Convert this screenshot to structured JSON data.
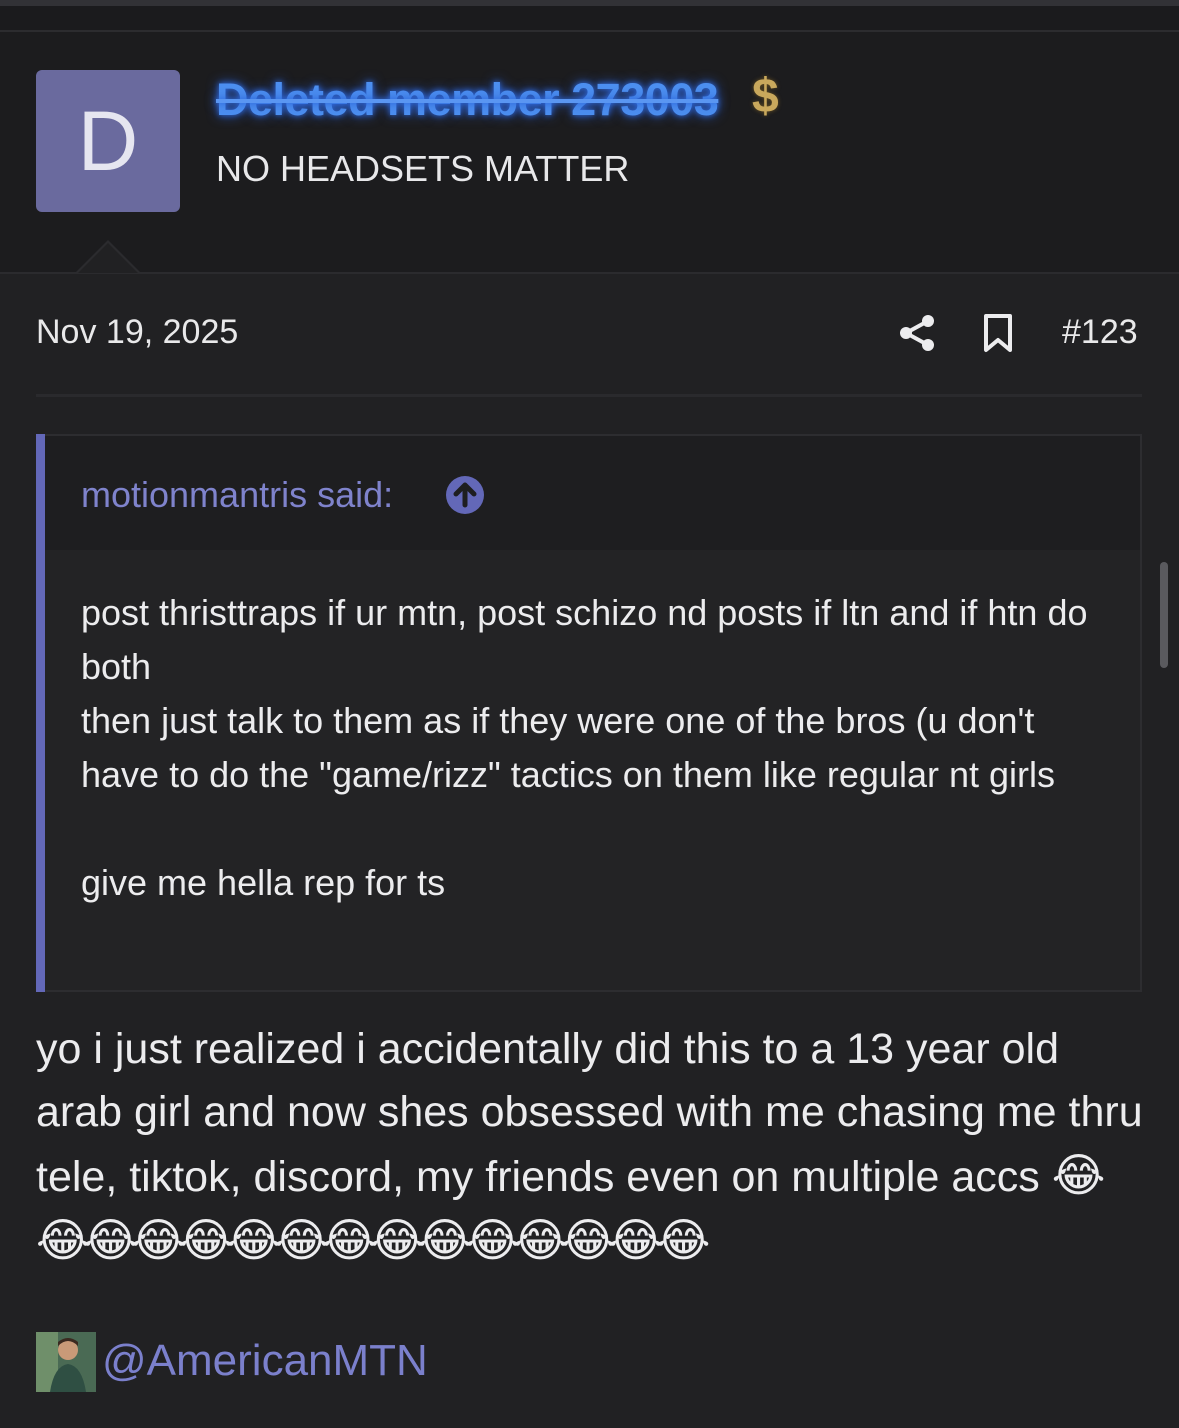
{
  "post": {
    "author": {
      "initial": "D",
      "name": "Deleted member 273003",
      "title": "NO HEADSETS MATTER",
      "badge_icon": "dollar-icon",
      "name_color": "#4c8ff0",
      "avatar_color": "#6a6a9e"
    },
    "date": "Nov 19, 2025",
    "number": "#123",
    "actions": {
      "share_icon": "share-icon",
      "bookmark_icon": "bookmark-icon"
    },
    "quote": {
      "author_line": "motionmantris said:",
      "jump_icon": "arrow-up-circle-icon",
      "lines": [
        "post thristtraps if ur mtn, post schizo nd posts if ltn and if htn do both",
        "then just talk to them as if they were one of the bros (u don't have to do the \"game/rizz\" tactics on them like regular nt girls",
        "give me hella rep for ts"
      ],
      "accent_color": "#6368b8"
    },
    "body_text": "yo i just realized i accidentally did this to a 13 year old arab girl and now shes obsessed with me chasing me thru tele, tiktok, discord, my friends even on multiple accs",
    "body_emojis": "😂😂😂😂😂😂😂😂😂😂😂😂😂😂😂",
    "signature": {
      "handle": "@AmericanMTN"
    }
  }
}
